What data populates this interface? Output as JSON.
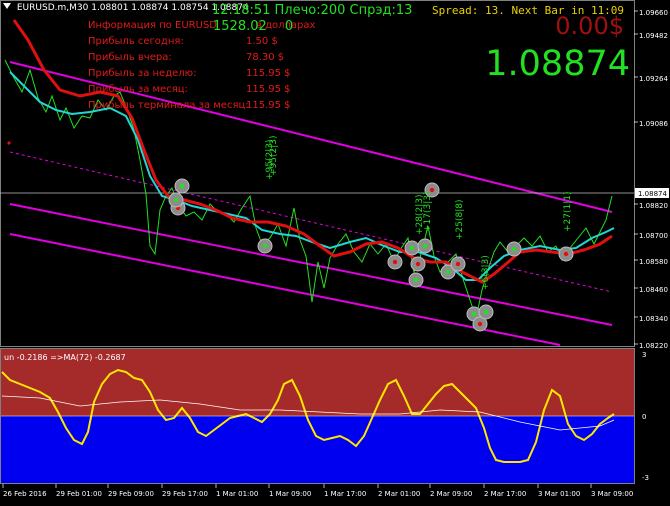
{
  "symbol_header": {
    "symbol": "EURUSD.m,M30",
    "ohlc": "1.08801 1.08874 1.08754 1.08874"
  },
  "panel": {
    "clock": "12:18:51 Плечо:200 Спрэд:13",
    "balance": "1528.02",
    "balance_suffix": "0",
    "spread_text": "Spread: 13. Next Bar in 11:09",
    "pnl": "0.00$",
    "big_price": "1.08874",
    "rows": [
      {
        "label": "Информация по EURUSD",
        "value": "",
        "extra": "в долларах"
      },
      {
        "label": "Прибыль сегодня:",
        "value": "1.50 $"
      },
      {
        "label": "Прибыль вчера:",
        "value": "78.30 $"
      },
      {
        "label": "Прибыль за неделю:",
        "value": "115.95 $"
      },
      {
        "label": "Прибыль за месяц:",
        "value": "115.95 $"
      },
      {
        "label": "Прибыль терминала за месяц:",
        "value": "115.95 $"
      }
    ]
  },
  "price_axis": {
    "labels": [
      "1.09660",
      "1.09482",
      "1.09264",
      "1.09086",
      "1.08874",
      "1.08820",
      "1.08700",
      "1.08580",
      "1.08460",
      "1.08340",
      "1.08220"
    ],
    "current": "1.08874"
  },
  "oscillator": {
    "label": "un -0.2186 =>MA(72) -0.2687",
    "axis_labels": [
      "3",
      "0",
      "-3"
    ]
  },
  "time_axis": {
    "labels": [
      "26 Feb 2016",
      "29 Feb 01:00",
      "29 Feb 09:00",
      "29 Feb 17:00",
      "1 Mar 01:00",
      "1 Mar 09:00",
      "1 Mar 17:00",
      "2 Mar 01:00",
      "2 Mar 09:00",
      "2 Mar 17:00",
      "3 Mar 01:00",
      "3 Mar 09:00"
    ]
  },
  "trade_labels": [
    "+95(2|3)",
    "+95(2|3)",
    "+28(2|3)",
    "+17(3|3)",
    "+25(8|8)",
    "+27(1|1)",
    "+6(3|3)"
  ],
  "colors": {
    "background": "#000000",
    "price_line": "#22e022",
    "ma_red": "#e01010",
    "ma_cyan": "#22d6d6",
    "channel": "#e000e0",
    "osc_positive": "#a52a2a",
    "osc_negative": "#0000f0",
    "osc_line": "#ffe600"
  }
}
